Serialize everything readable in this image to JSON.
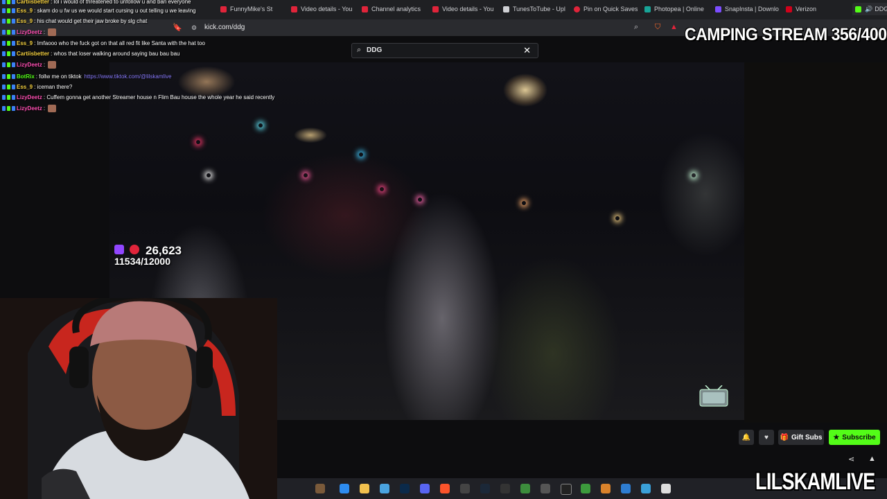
{
  "browser": {
    "tabs": [
      {
        "label": "FunnyMike's St",
        "color": "#e0243a"
      },
      {
        "label": "Video details - You",
        "color": "#e0243a"
      },
      {
        "label": "Channel analytics",
        "color": "#e0243a"
      },
      {
        "label": "Video details - You",
        "color": "#e0243a"
      },
      {
        "label": "TunesToTube - Upl",
        "color": "#cfd0d4"
      },
      {
        "label": "Pin on Quick Saves",
        "color": "#e0243a"
      },
      {
        "label": "Photopea | Online",
        "color": "#18a497"
      },
      {
        "label": "SnapInsta | Downlo",
        "color": "#7c4dff"
      },
      {
        "label": "Verizon",
        "color": "#d0021b"
      }
    ],
    "tab_right": "DDG",
    "url": "kick.com/ddg"
  },
  "search": {
    "value": "DDG"
  },
  "video": {
    "viewer_count": "26,623",
    "goal_progress": "11534/12000"
  },
  "actions": {
    "gift_subs": "Gift Subs",
    "subscribe": "Subscribe"
  },
  "overlay": {
    "stream_title": "CAMPING STREAM 356/400",
    "watermark": "LILSKAMLIVE"
  },
  "chat": [
    {
      "user": "Cartiisbetter",
      "text": ": lol i would of threatened to unfollow u and ban everyone",
      "color": "#f4d03f"
    },
    {
      "user": "Ess_9",
      "text": ": skam do u fw us we would start cursing u out telling u we leaving",
      "color": "#f4d03f"
    },
    {
      "user": "Ess_9",
      "text": ": his chat would get their jaw broke by slg chat",
      "color": "#f4d03f"
    },
    {
      "user": "LizyDeetz",
      "text": ":",
      "color": "#ff4fb3",
      "emote": true
    },
    {
      "user": "Ess_9",
      "text": ": Imfaooo who the fuck got on that all red fit like Santa with the hat too",
      "color": "#f4d03f"
    },
    {
      "user": "Cartiisbetter",
      "text": ": whos that loser walking around saying bau bau bau",
      "color": "#f4d03f"
    },
    {
      "user": "LizyDeetz",
      "text": ":",
      "color": "#ff4fb3",
      "emote": true
    },
    {
      "user": "BotRix",
      "text": ": follw me on tiktok",
      "color": "#53fc18",
      "link": "https://www.tiktok.com/@lilskamlive"
    },
    {
      "user": "Ess_9",
      "text": ": iceman there?",
      "color": "#f4d03f"
    },
    {
      "user": "LizyDeetz",
      "text": ": Cuffem gonna get another Streamer house n Flim Bau house the whole year he said recently",
      "color": "#ff4fb3"
    },
    {
      "user": "LizyDeetz",
      "text": ":",
      "color": "#ff4fb3",
      "emote": true
    }
  ],
  "icons": {
    "search": "search-icon",
    "clear": "close-icon",
    "bell": "bell-icon",
    "heart": "heart-icon",
    "gift": "gift-icon",
    "star": "star-icon",
    "share": "share-icon",
    "alert": "warning-icon"
  }
}
